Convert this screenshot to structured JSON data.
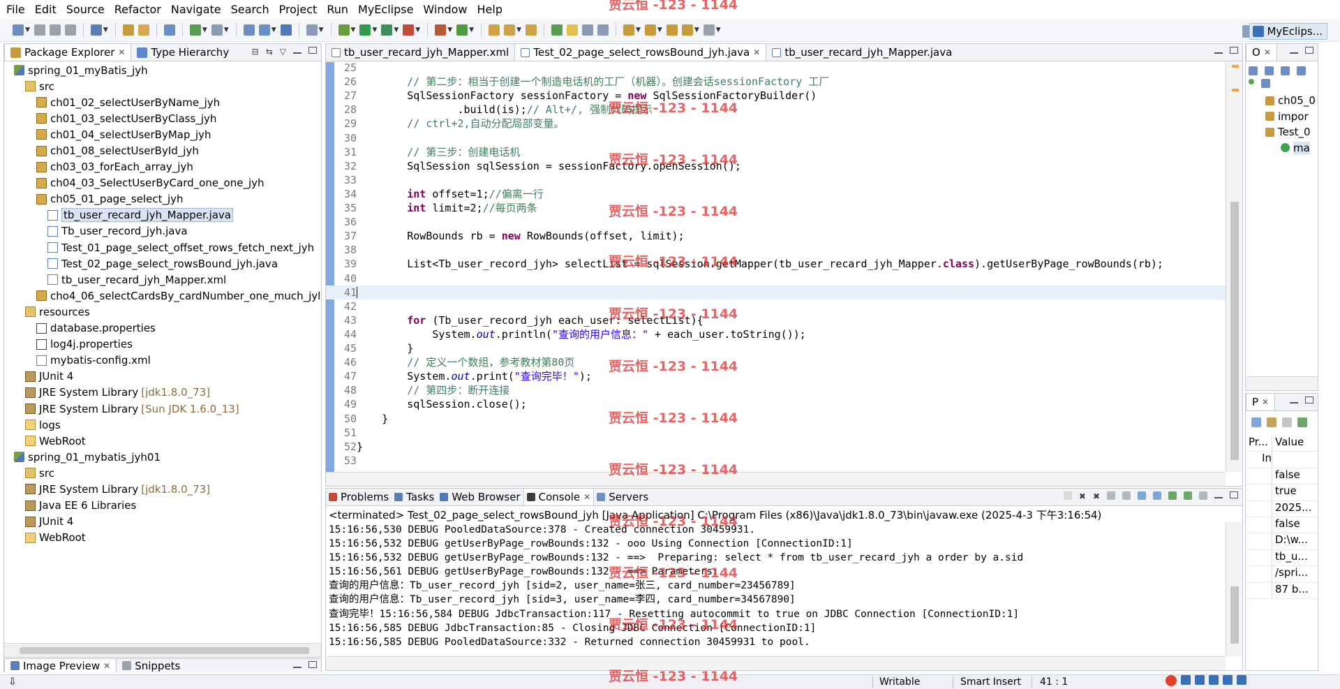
{
  "menu": [
    "File",
    "Edit",
    "Source",
    "Refactor",
    "Navigate",
    "Search",
    "Project",
    "Run",
    "MyEclipse",
    "Window",
    "Help"
  ],
  "perspective": {
    "label": "MyEclips..."
  },
  "package_explorer": {
    "tabs": [
      {
        "label": "Package Explorer",
        "active": true
      },
      {
        "label": "Type Hierarchy",
        "active": false
      }
    ],
    "tree": [
      {
        "indent": 0,
        "icon": "project",
        "label": "spring_01_myBatis_jyh",
        "decor": ""
      },
      {
        "indent": 1,
        "icon": "srcfolder",
        "label": "src",
        "decor": ""
      },
      {
        "indent": 2,
        "icon": "package",
        "label": "ch01_02_selectUserByName_jyh",
        "decor": ""
      },
      {
        "indent": 2,
        "icon": "package",
        "label": "ch01_03_selectUserByClass_jyh",
        "decor": ""
      },
      {
        "indent": 2,
        "icon": "package",
        "label": "ch01_04_selectUserByMap_jyh",
        "decor": ""
      },
      {
        "indent": 2,
        "icon": "package",
        "label": "ch01_08_selectUserById_jyh",
        "decor": ""
      },
      {
        "indent": 2,
        "icon": "package",
        "label": "ch03_03_forEach_array_jyh",
        "decor": ""
      },
      {
        "indent": 2,
        "icon": "package",
        "label": "ch04_03_SelectUserByCard_one_one_jyh",
        "decor": ""
      },
      {
        "indent": 2,
        "icon": "package",
        "label": "ch05_01_page_select_jyh",
        "decor": ""
      },
      {
        "indent": 3,
        "icon": "java",
        "label": "tb_user_recard_jyh_Mapper.java",
        "decor": "",
        "selected": true
      },
      {
        "indent": 3,
        "icon": "java",
        "label": "Tb_user_record_jyh.java",
        "decor": ""
      },
      {
        "indent": 3,
        "icon": "java",
        "label": "Test_01_page_select_offset_rows_fetch_next_jyh",
        "decor": ""
      },
      {
        "indent": 3,
        "icon": "java",
        "label": "Test_02_page_select_rowsBound_jyh.java",
        "decor": ""
      },
      {
        "indent": 3,
        "icon": "xml",
        "label": "tb_user_recard_jyh_Mapper.xml",
        "decor": ""
      },
      {
        "indent": 2,
        "icon": "package",
        "label": "cho4_06_selectCardsBy_cardNumber_one_much_jyl",
        "decor": ""
      },
      {
        "indent": 1,
        "icon": "srcfolder",
        "label": "resources",
        "decor": ""
      },
      {
        "indent": 2,
        "icon": "props",
        "label": "database.properties",
        "decor": ""
      },
      {
        "indent": 2,
        "icon": "props",
        "label": "log4j.properties",
        "decor": ""
      },
      {
        "indent": 2,
        "icon": "xml",
        "label": "mybatis-config.xml",
        "decor": ""
      },
      {
        "indent": 1,
        "icon": "library",
        "label": "JUnit 4",
        "decor": ""
      },
      {
        "indent": 1,
        "icon": "library",
        "label": "JRE System Library",
        "decor": "[jdk1.8.0_73]"
      },
      {
        "indent": 1,
        "icon": "library",
        "label": "JRE System Library",
        "decor": "[Sun JDK 1.6.0_13]"
      },
      {
        "indent": 1,
        "icon": "folder",
        "label": "logs",
        "decor": ""
      },
      {
        "indent": 1,
        "icon": "folder",
        "label": "WebRoot",
        "decor": ""
      },
      {
        "indent": 0,
        "icon": "project",
        "label": "spring_01_mybatis_jyh01",
        "decor": ""
      },
      {
        "indent": 1,
        "icon": "srcfolder",
        "label": "src",
        "decor": ""
      },
      {
        "indent": 1,
        "icon": "library",
        "label": "JRE System Library",
        "decor": "[jdk1.8.0_73]"
      },
      {
        "indent": 1,
        "icon": "library",
        "label": "Java EE 6 Libraries",
        "decor": ""
      },
      {
        "indent": 1,
        "icon": "library",
        "label": "JUnit 4",
        "decor": ""
      },
      {
        "indent": 1,
        "icon": "folder",
        "label": "WebRoot",
        "decor": ""
      }
    ]
  },
  "editor": {
    "tabs": [
      {
        "label": "tb_user_recard_jyh_Mapper.xml",
        "icon": "xml",
        "active": false
      },
      {
        "label": "Test_02_page_select_rowsBound_jyh.java",
        "icon": "java",
        "active": true
      },
      {
        "label": "tb_user_recard_jyh_Mapper.java",
        "icon": "java",
        "active": false
      }
    ],
    "lines": [
      {
        "n": "25",
        "parts": []
      },
      {
        "n": "26",
        "parts": [
          [
            "c-comment",
            "        // 第二步：相当于创建一个制造电话机的工厂（机器）。创建会话sessionFactory 工厂"
          ]
        ]
      },
      {
        "n": "27",
        "parts": [
          [
            "",
            "        SqlSessionFactory sessionFactory = "
          ],
          [
            "c-kw",
            "new"
          ],
          [
            "",
            " SqlSessionFactoryBuilder()"
          ]
        ]
      },
      {
        "n": "28",
        "parts": [
          [
            "",
            "                .build(is);"
          ],
          [
            "c-comment",
            "// Alt+/, 强制代码提示"
          ]
        ]
      },
      {
        "n": "29",
        "parts": [
          [
            "c-comment",
            "        // ctrl+2,自动分配局部变量。"
          ]
        ]
      },
      {
        "n": "30",
        "parts": []
      },
      {
        "n": "31",
        "parts": [
          [
            "c-comment",
            "        // 第三步：创建电话机"
          ]
        ]
      },
      {
        "n": "32",
        "parts": [
          [
            "",
            "        SqlSession sqlSession = sessionFactory.openSession();"
          ]
        ]
      },
      {
        "n": "33",
        "parts": []
      },
      {
        "n": "34",
        "parts": [
          [
            "c-kw",
            "        int"
          ],
          [
            "",
            " offset=1;"
          ],
          [
            "c-comment",
            "//偏离一行"
          ]
        ]
      },
      {
        "n": "35",
        "parts": [
          [
            "c-kw",
            "        int"
          ],
          [
            "",
            " limit=2;"
          ],
          [
            "c-comment",
            "//每页两条"
          ]
        ]
      },
      {
        "n": "36",
        "parts": []
      },
      {
        "n": "37",
        "parts": [
          [
            "",
            "        RowBounds rb = "
          ],
          [
            "c-kw",
            "new"
          ],
          [
            "",
            " RowBounds(offset, limit);"
          ]
        ]
      },
      {
        "n": "38",
        "parts": []
      },
      {
        "n": "39",
        "parts": [
          [
            "",
            "        List<Tb_user_record_jyh> selectList = sqlSession.getMapper(tb_user_recard_jyh_Mapper."
          ],
          [
            "c-kw",
            "class"
          ],
          [
            "",
            ").getUserByPage_rowBounds(rb);"
          ]
        ]
      },
      {
        "n": "40",
        "parts": []
      },
      {
        "n": "41",
        "parts": [
          [
            "",
            ""
          ]
        ],
        "current": true
      },
      {
        "n": "42",
        "parts": []
      },
      {
        "n": "43",
        "parts": [
          [
            "c-kw",
            "        for"
          ],
          [
            "",
            " (Tb_user_record_jyh each_user: selectList){"
          ]
        ]
      },
      {
        "n": "44",
        "parts": [
          [
            "",
            "            System."
          ],
          [
            "c-field",
            "out"
          ],
          [
            "",
            ".println("
          ],
          [
            "c-str",
            "\"查询的用户信息：\""
          ],
          [
            "",
            " + each_user.toString());"
          ]
        ]
      },
      {
        "n": "45",
        "parts": [
          [
            "",
            "        }"
          ]
        ]
      },
      {
        "n": "46",
        "parts": [
          [
            "c-comment",
            "        // 定义一个数组，参考教材第80页"
          ]
        ]
      },
      {
        "n": "47",
        "parts": [
          [
            "",
            "        System."
          ],
          [
            "c-field",
            "out"
          ],
          [
            "",
            ".print("
          ],
          [
            "c-str",
            "\"查询完毕！\""
          ],
          [
            "",
            ");"
          ]
        ]
      },
      {
        "n": "48",
        "parts": [
          [
            "c-comment",
            "        // 第四步：断开连接"
          ]
        ]
      },
      {
        "n": "49",
        "parts": [
          [
            "",
            "        sqlSession.close();"
          ]
        ]
      },
      {
        "n": "50",
        "parts": [
          [
            "",
            "    }"
          ]
        ]
      },
      {
        "n": "51",
        "parts": []
      },
      {
        "n": "52",
        "parts": [
          [
            "",
            "}"
          ]
        ]
      },
      {
        "n": "53",
        "parts": []
      }
    ]
  },
  "console": {
    "tabs": [
      {
        "label": "Problems",
        "active": false
      },
      {
        "label": "Tasks",
        "active": false
      },
      {
        "label": "Web Browser",
        "active": false
      },
      {
        "label": "Console",
        "active": true
      },
      {
        "label": "Servers",
        "active": false
      }
    ],
    "status": "<terminated> Test_02_page_select_rowsBound_jyh [Java Application] C:\\Program Files (x86)\\Java\\jdk1.8.0_73\\bin\\javaw.exe (2025-4-3 下午3:16:54)",
    "lines": [
      "15:16:56,530 DEBUG PooledDataSource:378 - Created connection 30459931.",
      "15:16:56,532 DEBUG getUserByPage_rowBounds:132 - ooo Using Connection [ConnectionID:1]",
      "15:16:56,532 DEBUG getUserByPage_rowBounds:132 - ==>  Preparing: select * from tb_user_recard_jyh a order by a.sid",
      "15:16:56,561 DEBUG getUserByPage_rowBounds:132 - ==> Parameters:",
      "查询的用户信息：Tb_user_record_jyh [sid=2, user_name=张三, card_number=23456789]",
      "查询的用户信息：Tb_user_record_jyh [sid=3, user_name=李四, card_number=34567890]",
      "查询完毕！15:16:56,584 DEBUG JdbcTransaction:117 - Resetting autocommit to true on JDBC Connection [ConnectionID:1]",
      "15:16:56,585 DEBUG JdbcTransaction:85 - Closing JDBC Connection [ConnectionID:1]",
      "15:16:56,585 DEBUG PooledDataSource:332 - Returned connection 30459931 to pool."
    ]
  },
  "outline": {
    "tab": "O",
    "items": [
      {
        "label": "ch05_0",
        "indent": 0
      },
      {
        "label": "impor",
        "indent": 0
      },
      {
        "label": "Test_0",
        "indent": 0
      },
      {
        "label": "ma",
        "indent": 1,
        "selected": true
      }
    ]
  },
  "properties": {
    "tab": "P",
    "header": [
      "Pr...",
      "Value"
    ],
    "subheader": "In",
    "rows": [
      [
        "",
        "false"
      ],
      [
        "",
        "true"
      ],
      [
        "",
        "2025..."
      ],
      [
        "",
        "false"
      ],
      [
        "",
        "D:\\w..."
      ],
      [
        "",
        "tb_u..."
      ],
      [
        "",
        "/spri..."
      ],
      [
        "",
        "87 b..."
      ]
    ]
  },
  "bottom_left": {
    "tabs": [
      {
        "label": "Image Preview",
        "active": true
      },
      {
        "label": "Snippets",
        "active": false
      }
    ]
  },
  "statusbar": {
    "writable": "Writable",
    "insert_mode": "Smart Insert",
    "position": "41 : 1"
  },
  "watermark": "贾云恒 -123 - 1144",
  "colors": {
    "accent": "#5a8ad6",
    "comment": "#3f7f5f",
    "keyword": "#7f0055",
    "string": "#2a00ff"
  }
}
